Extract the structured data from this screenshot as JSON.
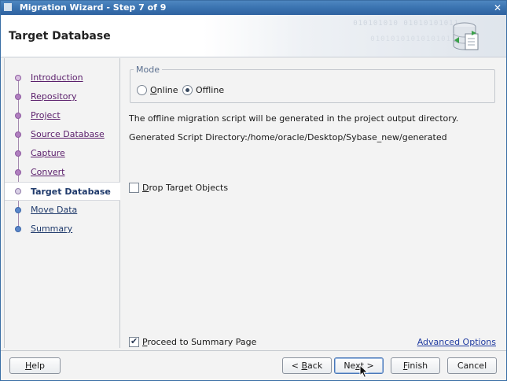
{
  "window": {
    "title": "Migration Wizard - Step 7 of 9",
    "close": "✕"
  },
  "header": {
    "title": "Target Database",
    "deco1": "010101010 01010101011",
    "deco2": "0101010101010101"
  },
  "steps": [
    {
      "label": "Introduction",
      "state": "done"
    },
    {
      "label": "Repository",
      "state": "done"
    },
    {
      "label": "Project",
      "state": "done"
    },
    {
      "label": "Source Database",
      "state": "done"
    },
    {
      "label": "Capture ",
      "state": "done"
    },
    {
      "label": "Convert",
      "state": "done"
    },
    {
      "label": "Target Database",
      "state": "active"
    },
    {
      "label": "Move Data",
      "state": "future"
    },
    {
      "label": "Summary",
      "state": "future"
    }
  ],
  "mode": {
    "legend": "Mode",
    "online_mnemonic": "O",
    "online_rest": "nline",
    "offline_pre": "Off",
    "offline_mnemonic": "l",
    "offline_rest": "ine",
    "selected": "Offline"
  },
  "info": {
    "line1": "The offline migration script will be generated in the project output directory.",
    "line2": "Generated Script Directory:/home/oracle/Desktop/Sybase_new/generated"
  },
  "drop_target": {
    "mnemonic": "D",
    "rest": "rop Target Objects",
    "checked": false
  },
  "proceed_summary": {
    "mnemonic": "P",
    "rest": "roceed to Summary Page",
    "checked": true
  },
  "advanced_options": "Advanced Options",
  "buttons": {
    "help_mnemonic": "H",
    "help_rest": "elp",
    "back_pre": "< ",
    "back_mnemonic": "B",
    "back_rest": "ack",
    "next_pre": "Ne",
    "next_mnemonic": "x",
    "next_rest": "t >",
    "finish_mnemonic": "F",
    "finish_rest": "inish",
    "cancel": "Cancel"
  }
}
